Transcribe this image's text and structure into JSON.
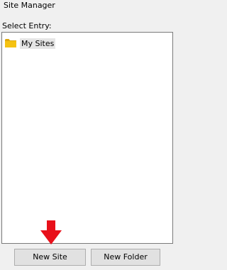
{
  "window": {
    "title": "Site Manager"
  },
  "tree": {
    "label": "Select Entry:",
    "items": [
      {
        "label": "My Sites",
        "icon": "folder-icon",
        "selected": true
      }
    ]
  },
  "buttons": {
    "new_site": "New Site",
    "new_folder": "New Folder"
  },
  "annotation": {
    "icon": "red-arrow-down-icon",
    "color": "#e8101a"
  },
  "colors": {
    "folder": "#f5c211",
    "folder_dark": "#dca70c",
    "selection": "#e5e5e5"
  }
}
